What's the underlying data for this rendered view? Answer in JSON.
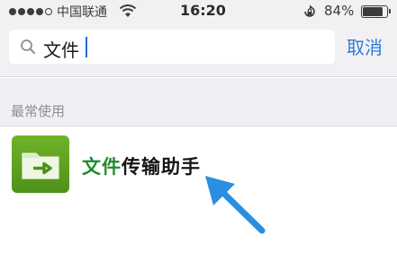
{
  "status_bar": {
    "carrier": "中国联通",
    "time": "16:20",
    "battery": "84%",
    "battery_level": 0.84,
    "signal_bars_filled": 4,
    "signal_bars_total": 5
  },
  "search": {
    "query": "文件",
    "cancel_label": "取消"
  },
  "section": {
    "title": "最常使用"
  },
  "results": [
    {
      "title_highlight": "文件",
      "title_rest": "传输助手",
      "icon": "folder-arrow-icon"
    }
  ],
  "annotation": {
    "icon": "arrow-pointer-icon",
    "color": "#2a8fe0"
  },
  "colors": {
    "accent_blue": "#2f7ad8",
    "match_green": "#1f8b2a",
    "app_icon_green": "#5ea323"
  }
}
